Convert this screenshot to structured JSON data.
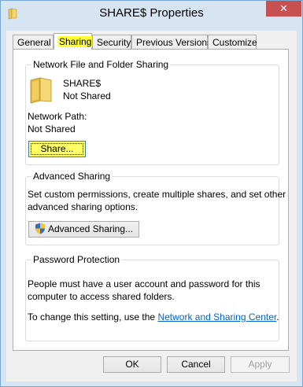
{
  "window": {
    "title": "SHARE$ Properties",
    "close_glyph": "✕"
  },
  "tabs": [
    {
      "label": "General"
    },
    {
      "label": "Sharing"
    },
    {
      "label": "Security"
    },
    {
      "label": "Previous Versions"
    },
    {
      "label": "Customize"
    }
  ],
  "network_sharing": {
    "group_label": "Network File and Folder Sharing",
    "folder_name": "SHARE$",
    "folder_status": "Not Shared",
    "path_label": "Network Path:",
    "path_value": "Not Shared",
    "share_button": "Share..."
  },
  "advanced_sharing": {
    "group_label": "Advanced Sharing",
    "description_line1": "Set custom permissions, create multiple shares, and set other",
    "description_line2": "advanced sharing options.",
    "button": "Advanced Sharing..."
  },
  "password_protection": {
    "group_label": "Password Protection",
    "description_line1": "People must have a user account and password for this",
    "description_line2": "computer to access shared folders.",
    "change_text": "To change this setting, use the ",
    "link_text": "Network and Sharing Center",
    "period": "."
  },
  "footer": {
    "ok": "OK",
    "cancel": "Cancel",
    "apply": "Apply"
  },
  "colors": {
    "highlight": "#ffff33",
    "link": "#0066cc",
    "close": "#c75050"
  },
  "icons": {
    "title": "folder-icon",
    "folder": "folder-icon",
    "shield": "uac-shield-icon"
  }
}
